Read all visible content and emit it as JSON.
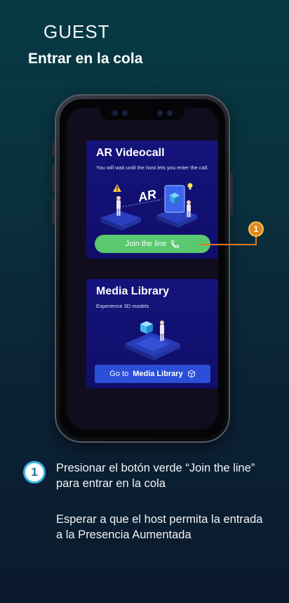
{
  "header": {
    "title": "GUEST",
    "subtitle": "Entrar en la cola"
  },
  "cards": [
    {
      "title": "AR Videocall",
      "description": "You will wait until the host lets you enter the call.",
      "illustration_text": "AR",
      "button_label": "Join the line",
      "button_icon": "phone-icon",
      "button_color": "#5ac86e"
    },
    {
      "title": "Media Library",
      "description": "Experience 3D models",
      "button_prefix": "Go to",
      "button_label": "Media Library",
      "button_icon": "cube-icon",
      "button_color": "#2b4fd8"
    }
  ],
  "callout": {
    "number": "1",
    "color": "#e07a1d"
  },
  "instructions": {
    "step_number": "1",
    "line1": "Presionar el botón verde “Join the line” para entrar en la cola",
    "line2": "Esperar a que el host permita la entrada a la Presencia Aumentada"
  }
}
